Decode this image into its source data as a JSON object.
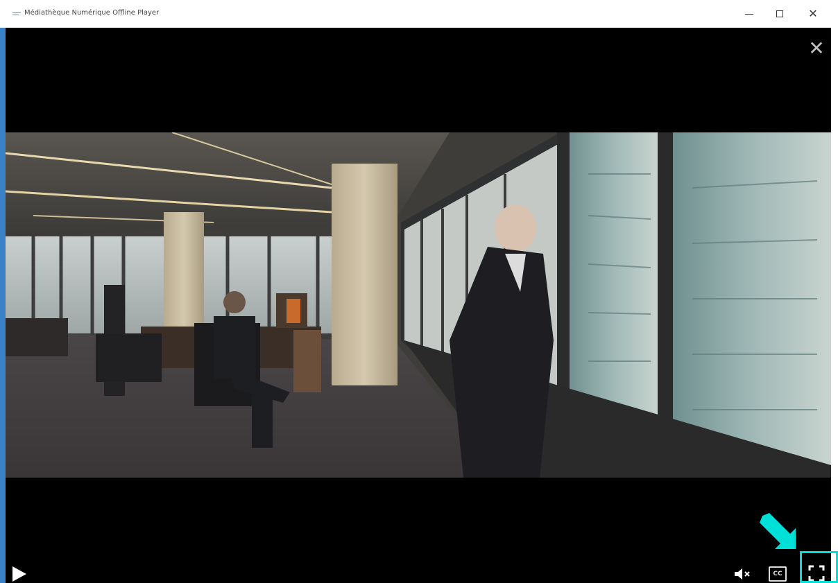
{
  "window": {
    "title": "Médiathèque Numérique Offline Player"
  },
  "icons": {
    "app": "menu-icon",
    "minimize": "minimize-icon",
    "maximize": "maximize-icon",
    "close": "close-icon",
    "player_close": "close-icon",
    "play": "play-icon",
    "mute": "volume-muted-icon",
    "captions": "closed-captions-icon",
    "fullscreen": "fullscreen-icon"
  },
  "controls": {
    "cc_label": "CC"
  },
  "colors": {
    "highlight": "#00e0d8",
    "player_background": "#000000",
    "window_border": "#3a82c8"
  }
}
